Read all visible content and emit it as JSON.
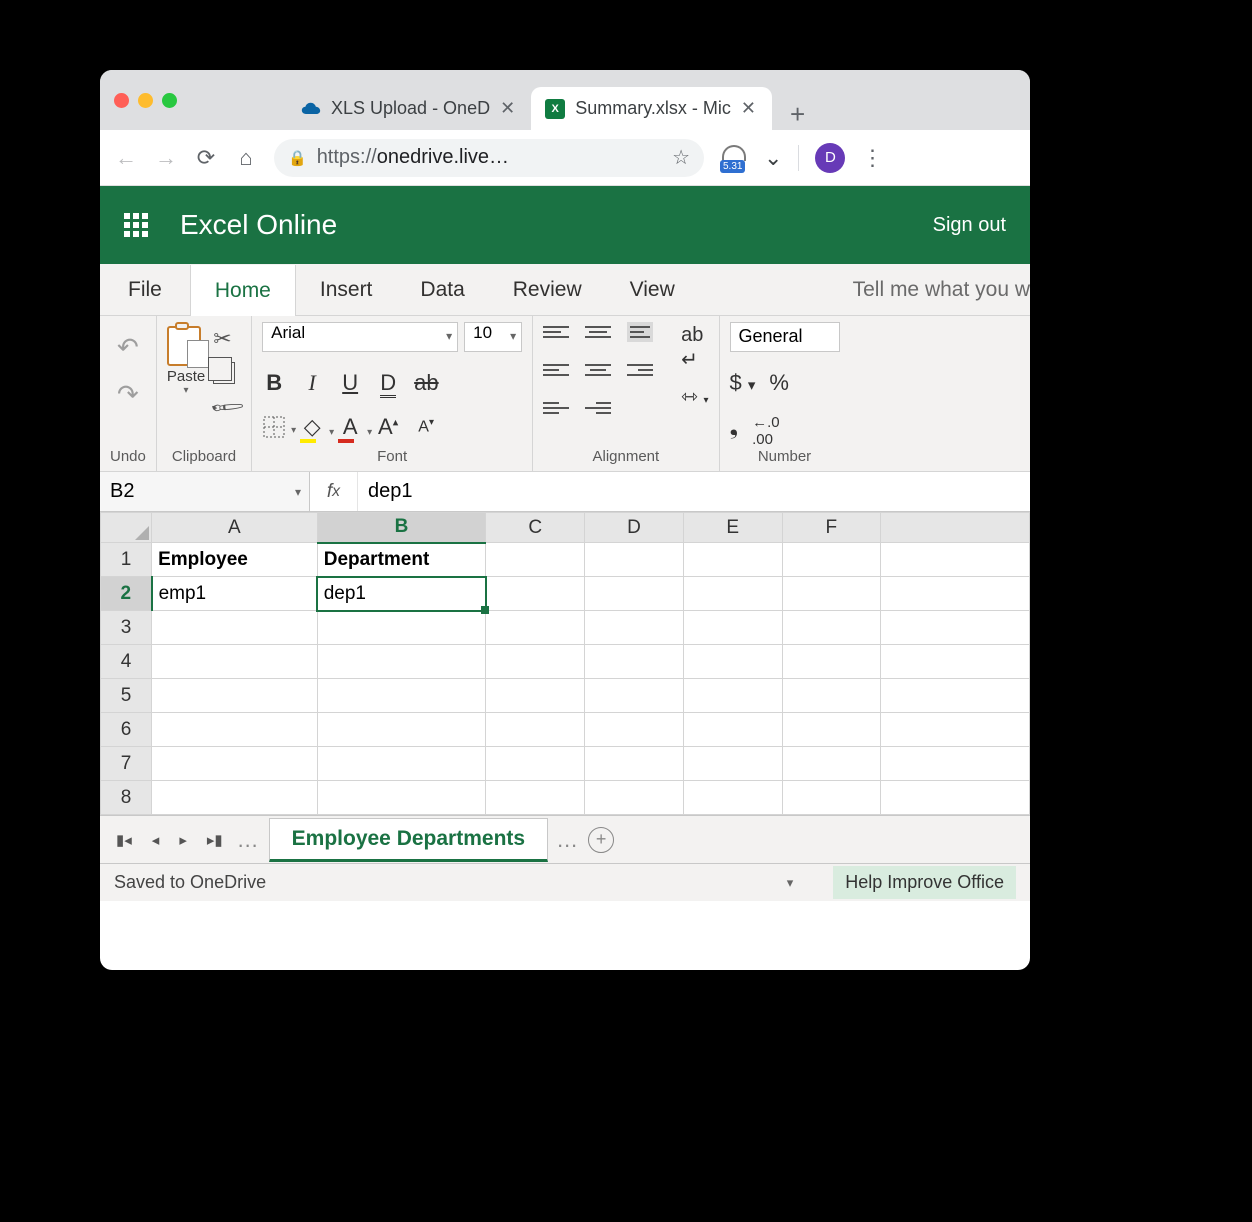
{
  "browser": {
    "tabs": [
      {
        "title": "XLS Upload - OneD",
        "icon": "onedrive"
      },
      {
        "title": "Summary.xlsx - Mic",
        "icon": "excel"
      }
    ],
    "url_display": "https://onedrive.live…",
    "ext_badge": "5.31",
    "avatar_letter": "D"
  },
  "excel": {
    "app_title": "Excel Online",
    "sign_out": "Sign out",
    "ribbon_tabs": {
      "file": "File",
      "home": "Home",
      "insert": "Insert",
      "data": "Data",
      "review": "Review",
      "view": "View",
      "tellme": "Tell me what you w"
    },
    "groups": {
      "undo": "Undo",
      "clipboard": "Clipboard",
      "font": "Font",
      "alignment": "Alignment",
      "number": "Number"
    },
    "paste_label": "Paste",
    "font_name": "Arial",
    "font_size": "10",
    "number_format": "General",
    "name_box": "B2",
    "formula": "dep1",
    "columns": [
      "A",
      "B",
      "C",
      "D",
      "E",
      "F"
    ],
    "rows": [
      "1",
      "2",
      "3",
      "4",
      "5",
      "6",
      "7",
      "8"
    ],
    "cells": {
      "A1": "Employee",
      "B1": "Department",
      "A2": "emp1",
      "B2": "dep1"
    },
    "sheet_tab": "Employee Departments",
    "status_saved": "Saved to OneDrive",
    "help_improve": "Help Improve Office"
  }
}
